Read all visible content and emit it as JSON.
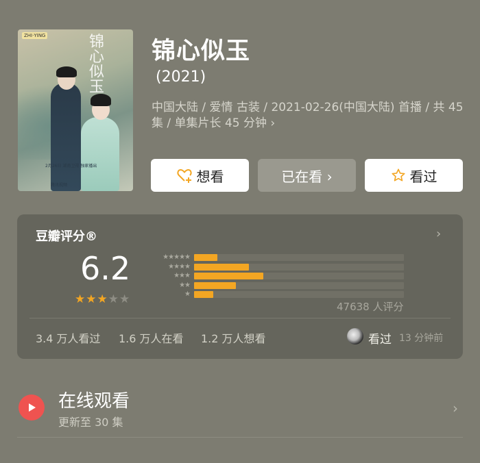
{
  "drama": {
    "title": "锦心似玉",
    "year": "(2021)",
    "meta": "中国大陆 / 爱情 古装 / 2021-02-26(中国大陆) 首播 / 共 45 集 / 单集片长 45 分钟 ›",
    "poster": {
      "calligraphy": "锦心似玉",
      "logo": "ZHI·YING",
      "caption": "2月26日 湖南卫视 独家播出",
      "brand": "腾讯视频"
    }
  },
  "actions": {
    "want": "想看",
    "watching": "已在看 ›",
    "watched": "看过"
  },
  "rating": {
    "title": "豆瓣评分®",
    "score": "6.2",
    "stars_filled": 3,
    "stars_total": 5,
    "distribution": [
      {
        "stars": "★★★★★",
        "fraction": 0.11
      },
      {
        "stars": "★★★★",
        "fraction": 0.26
      },
      {
        "stars": "★★★",
        "fraction": 0.33
      },
      {
        "stars": "★★",
        "fraction": 0.2
      },
      {
        "stars": "★",
        "fraction": 0.09
      }
    ],
    "count": "47638 人评分",
    "stats": {
      "watched": "3.4 万人看过",
      "watching": "1.6 万人在看",
      "want": "1.2 万人想看"
    },
    "friend": {
      "label": "看过",
      "time": "13 分钟前"
    }
  },
  "online": {
    "title": "在线观看",
    "subtitle": "更新至 30 集"
  },
  "colors": {
    "accent": "#f3a623",
    "play": "#ef5350",
    "background": "#7d7c71",
    "card": "#65655c"
  }
}
